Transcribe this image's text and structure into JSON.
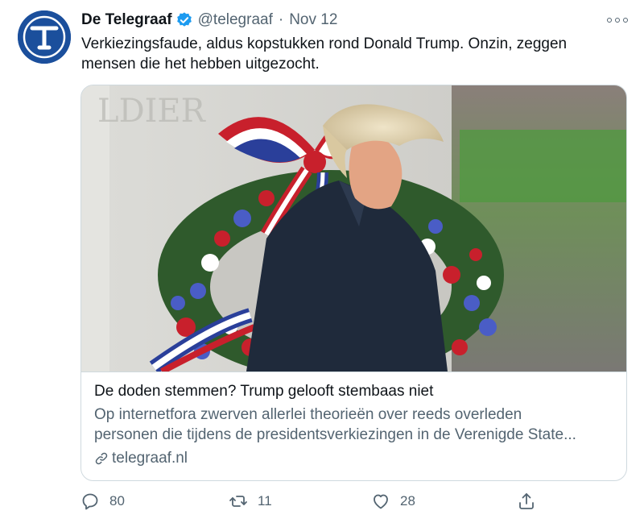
{
  "account": {
    "name": "De Telegraaf",
    "handle": "@telegraaf",
    "separator": "·",
    "date": "Nov 12"
  },
  "tweet": {
    "text": "Verkiezingsfaude, aldus kopstukken rond Donald Trump. Onzin, zeggen mensen die het hebben uitgezocht."
  },
  "card": {
    "title": "De doden stemmen? Trump gelooft stembaas niet",
    "description_line1": "Op internetfora zwerven allerlei theorieën over reeds overleden",
    "description_line2": "personen die tijdens de presidentsverkiezingen in de Verenigde State...",
    "domain": "telegraaf.nl"
  },
  "actions": {
    "replies": "80",
    "retweets": "11",
    "likes": "28"
  },
  "icons": {
    "avatar": "telegraaf-logo-icon",
    "verified": "verified-badge-icon",
    "more": "more-options-icon",
    "link": "link-icon",
    "reply": "reply-icon",
    "retweet": "retweet-icon",
    "like": "heart-icon",
    "share": "share-icon"
  },
  "colors": {
    "brand_blue": "#1b4f9c",
    "verified_blue": "#1d9bf0",
    "text": "#0f1419",
    "secondary_text": "#536471",
    "border": "#cfd9de"
  }
}
